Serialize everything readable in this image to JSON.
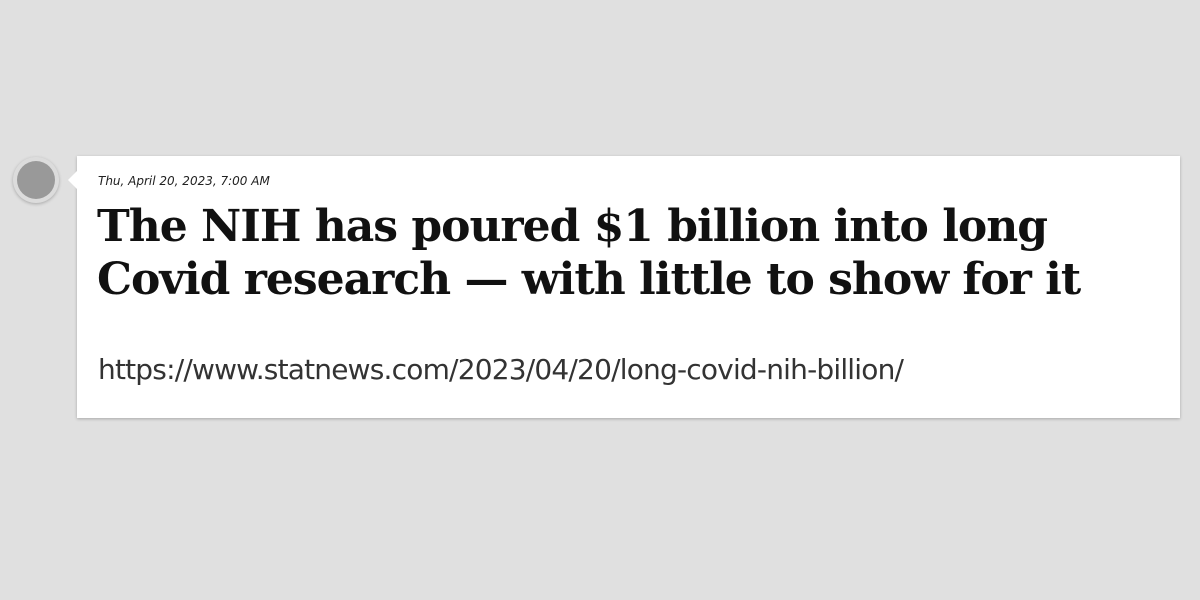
{
  "post": {
    "avatar_icon": "user-avatar-placeholder",
    "timestamp": "Thu, April 20, 2023, 7:00 AM",
    "headline": "The NIH has poured $1 billion into long Covid research — with little to show for it",
    "url": "https://www.statnews.com/2023/04/20/long-covid-nih-billion/"
  },
  "colors": {
    "background": "#e0e0e0",
    "card": "#ffffff",
    "avatar": "#999999"
  }
}
